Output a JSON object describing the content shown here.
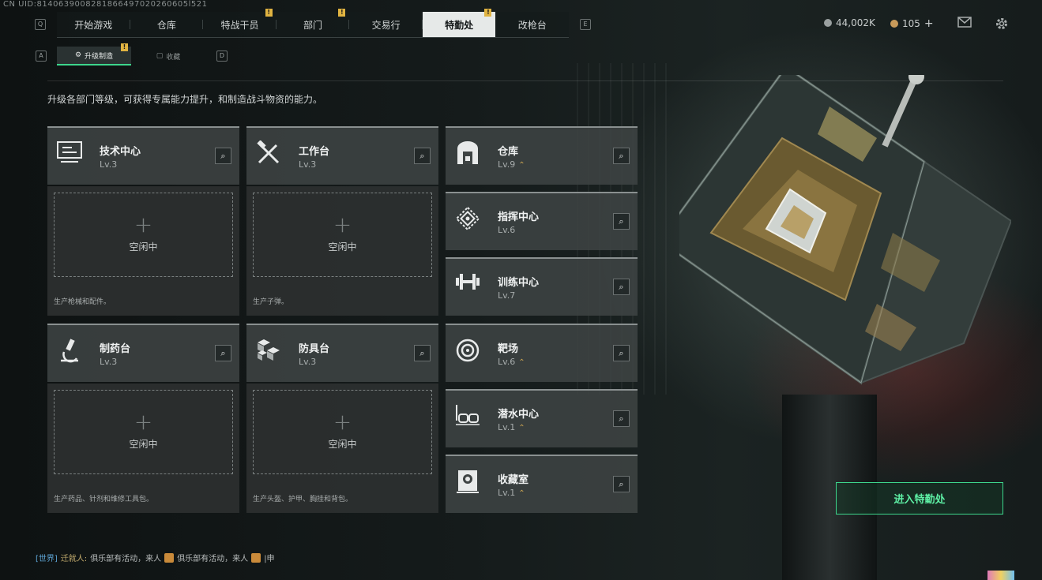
{
  "uid": "CN UID:8140639008281866497020260605l521",
  "top_nav": {
    "left_key": "Q",
    "right_key": "E",
    "tabs": [
      {
        "label": "开始游戏",
        "active": false,
        "badge": ""
      },
      {
        "label": "仓库",
        "active": false,
        "badge": ""
      },
      {
        "label": "特战干员",
        "active": false,
        "badge": "!"
      },
      {
        "label": "部门",
        "active": false,
        "badge": "!"
      },
      {
        "label": "交易行",
        "active": false,
        "badge": ""
      },
      {
        "label": "特勤处",
        "active": true,
        "badge": "!"
      },
      {
        "label": "改枪台",
        "active": false,
        "badge": ""
      }
    ]
  },
  "currency": {
    "coins": "44,002K",
    "tokens": "105",
    "add": "+"
  },
  "icons": {
    "mail": "mail-icon",
    "settings": "gear-icon"
  },
  "sub_nav": {
    "left_key": "A",
    "right_key": "D",
    "tabs": [
      {
        "label": "升级制造",
        "active": true,
        "badge": "!"
      },
      {
        "label": "收藏",
        "active": false,
        "badge": ""
      }
    ]
  },
  "description": "升级各部门等级，可获得专属能力提升，和制造战斗物资的能力。",
  "workshops": [
    {
      "title": "技术中心",
      "level": "Lv.3",
      "icon": "computer-icon",
      "idle": "空闲中",
      "note": "生产枪械和配件。"
    },
    {
      "title": "工作台",
      "level": "Lv.3",
      "icon": "tools-icon",
      "idle": "空闲中",
      "note": "生产子弹。"
    },
    {
      "title": "制药台",
      "level": "Lv.3",
      "icon": "microscope-icon",
      "idle": "空闲中",
      "note": "生产药品、针剂和维修工具包。"
    },
    {
      "title": "防具台",
      "level": "Lv.3",
      "icon": "cubes-icon",
      "idle": "空闲中",
      "note": "生产头盔、护甲、胸挂和背包。"
    }
  ],
  "departments": [
    {
      "title": "仓库",
      "level": "Lv.9",
      "icon": "warehouse-icon",
      "upgradable": true
    },
    {
      "title": "指挥中心",
      "level": "Lv.6",
      "icon": "chip-icon",
      "upgradable": false
    },
    {
      "title": "训练中心",
      "level": "Lv.7",
      "icon": "dumbbell-icon",
      "upgradable": false
    },
    {
      "title": "靶场",
      "level": "Lv.6",
      "icon": "target-icon",
      "upgradable": true
    },
    {
      "title": "潜水中心",
      "level": "Lv.1",
      "icon": "diving-mask-icon",
      "upgradable": true
    },
    {
      "title": "收藏室",
      "level": "Lv.1",
      "icon": "collection-icon",
      "upgradable": true
    }
  ],
  "enter_button": "进入特勤处",
  "chat": {
    "channel": "[世界]",
    "name": "迁就人:",
    "message_a": "俱乐部有活动，来人",
    "message_b": "俱乐部有活动，来人",
    "tail": "|申"
  },
  "colors": {
    "accent": "#3dd68c",
    "badge": "#e0b341",
    "upgrade": "#c9a452",
    "chat_channel": "#5ea5d6"
  }
}
